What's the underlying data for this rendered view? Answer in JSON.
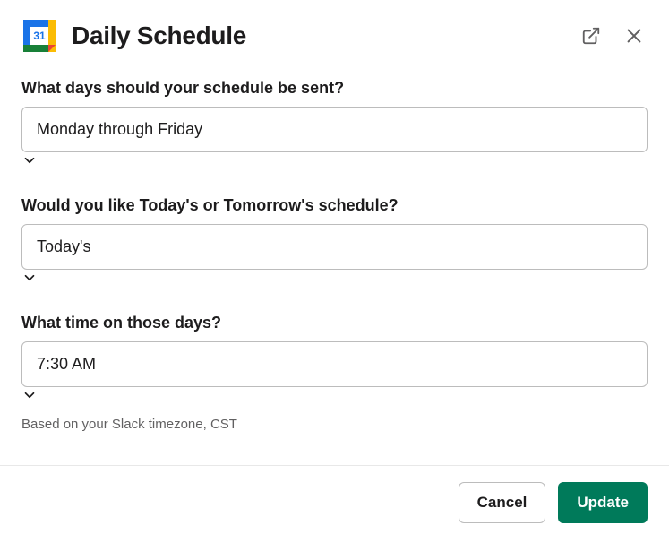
{
  "header": {
    "title": "Daily Schedule",
    "icon_day": "31"
  },
  "fields": {
    "days": {
      "label": "What days should your schedule be sent?",
      "value": "Monday through Friday"
    },
    "which": {
      "label": "Would you like Today's or Tomorrow's schedule?",
      "value": "Today's"
    },
    "time": {
      "label": "What time on those days?",
      "value": "7:30 AM",
      "hint": "Based on your Slack timezone, CST"
    }
  },
  "footer": {
    "cancel": "Cancel",
    "update": "Update"
  }
}
